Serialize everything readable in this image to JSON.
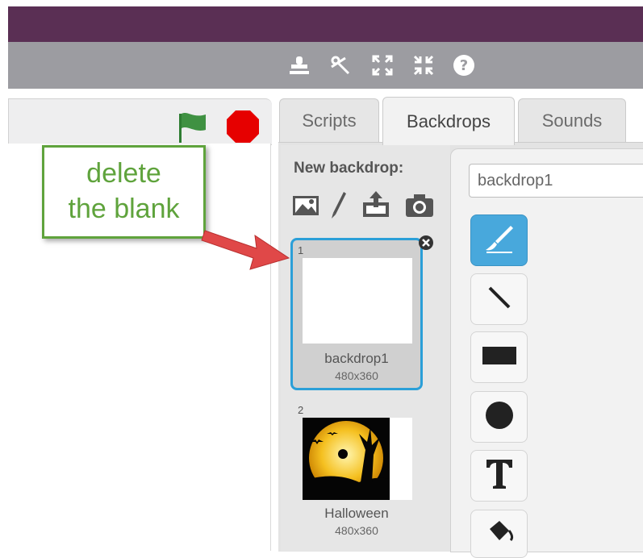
{
  "toolbar": {
    "icons": [
      "duplicate-stamp-icon",
      "cut-scissors-icon",
      "grow-icon",
      "shrink-icon",
      "help-icon"
    ]
  },
  "stage": {
    "green_flag_color": "#2e7d32",
    "stop_color": "#e60000"
  },
  "tabs": [
    {
      "label": "Scripts"
    },
    {
      "label": "Backdrops"
    },
    {
      "label": "Sounds"
    }
  ],
  "backdrops_panel": {
    "new_backdrop_label": "New backdrop:",
    "items": [
      {
        "number": "1",
        "name": "backdrop1",
        "size": "480x360"
      },
      {
        "number": "2",
        "name": "Halloween",
        "size": "480x360"
      }
    ]
  },
  "editor": {
    "name_value": "backdrop1",
    "tools": [
      "brush-icon",
      "line-icon",
      "rectangle-icon",
      "ellipse-icon",
      "text-icon",
      "fill-bucket-icon"
    ],
    "accent": "#48a8dc"
  },
  "annotation": {
    "line1": "delete",
    "line2": "the blank",
    "color": "#5fa33c"
  }
}
